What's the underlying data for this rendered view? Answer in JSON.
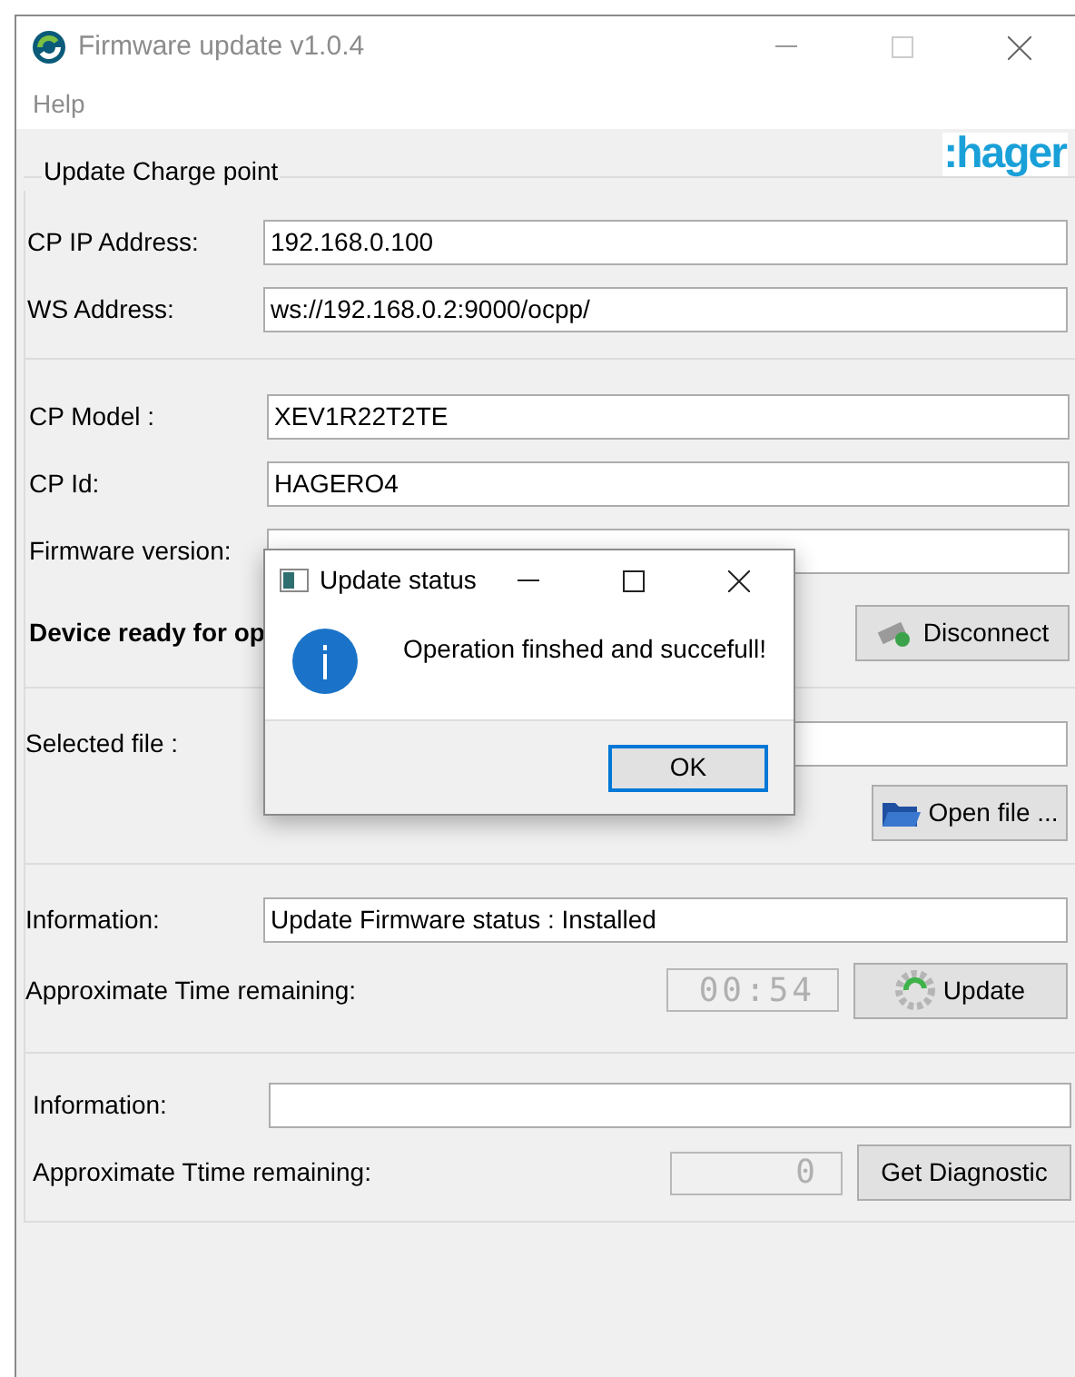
{
  "window": {
    "title": "Firmware update v1.0.4"
  },
  "menu": [
    "Help"
  ],
  "group_title": "Update Charge point",
  "logo": ":hager",
  "connection_fields": [
    {
      "label": "CP IP Address:",
      "value": "192.168.0.100"
    },
    {
      "label": "WS Address:",
      "value": "ws://192.168.0.2:9000/ocpp/"
    }
  ],
  "device_fields": [
    {
      "label": "CP Model :",
      "value": "XEV1R22T2TE"
    },
    {
      "label": "CP Id:",
      "value": "HAGERO4"
    },
    {
      "label": "Firmware version:"
    }
  ],
  "device_status": "Device ready for op",
  "disconnect_button": "Disconnect",
  "file": {
    "label": "Selected file :",
    "button": "Open file ..."
  },
  "update": {
    "info_label": "Information:",
    "info_value": "Update Firmware status : Installed",
    "time_label": "Approximate Time remaining:",
    "time": "00:54",
    "button": "Update"
  },
  "diagnostic": {
    "info_label": "Information:",
    "time_label": "Approximate Ttime remaining:",
    "time": "0",
    "button": "Get Diagnostic"
  },
  "dialog": {
    "title": "Update status",
    "message": "Operation finshed and succefull!",
    "button": "OK"
  }
}
